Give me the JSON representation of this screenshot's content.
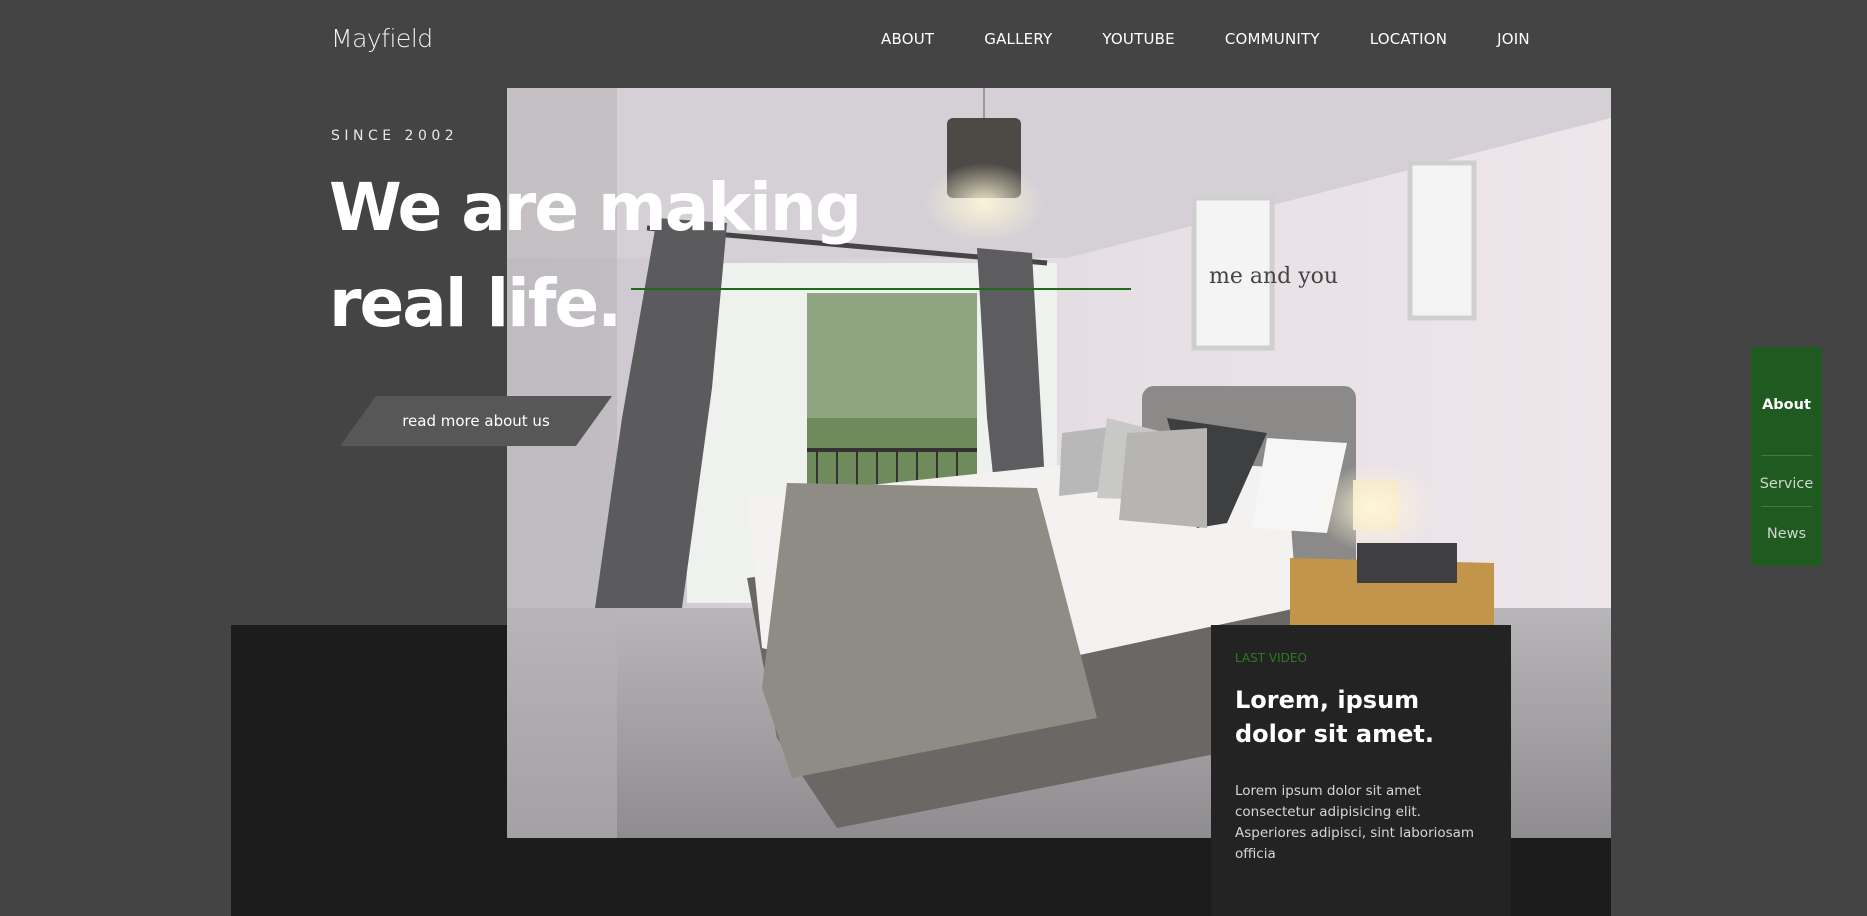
{
  "header": {
    "logo": "Mayfield",
    "nav": [
      "ABOUT",
      "GALLERY",
      "YOUTUBE",
      "COMMUNITY",
      "LOCATION",
      "JOIN"
    ]
  },
  "hero": {
    "kicker": "SINCE 2002",
    "headline_line1": "We are making",
    "headline_line2": "real life.",
    "cta_label": "read more about us",
    "image_alt": "bedroom-photo"
  },
  "video_card": {
    "kicker": "LAST VIDEO",
    "title": "Lorem, ipsum dolor sit amet.",
    "body": "Lorem ipsum dolor sit amet consectetur adipisicing elit. Asperiores adipisci, sint laboriosam officia"
  },
  "side_menu": {
    "items": [
      "About",
      "Service",
      "News"
    ],
    "active": "About"
  },
  "colors": {
    "background": "#444444",
    "accent_green": "#1f5a20",
    "kicker_green": "#2d7a22",
    "dark_band": "#1c1c1c"
  }
}
